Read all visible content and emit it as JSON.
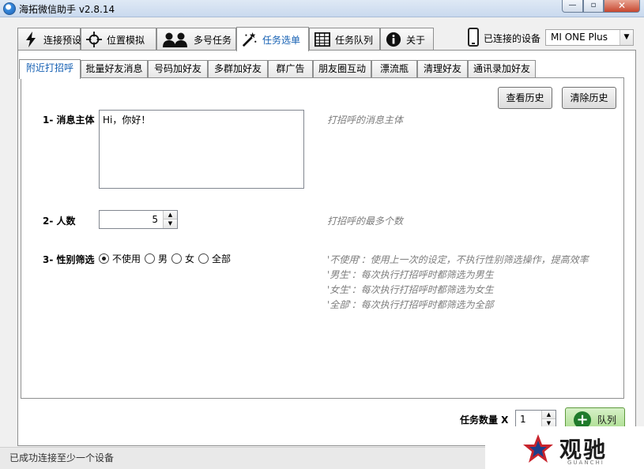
{
  "window": {
    "title": "海拓微信助手 v2.8.14"
  },
  "main_tabs": [
    {
      "label": "连接预设",
      "icon": "lightning-icon"
    },
    {
      "label": "位置模拟",
      "icon": "crosshair-icon"
    },
    {
      "label": "多号任务",
      "icon": "users-icon"
    },
    {
      "label": "任务选单",
      "icon": "magic-wand-icon"
    },
    {
      "label": "任务队列",
      "icon": "grid-icon"
    },
    {
      "label": "关于",
      "icon": "info-icon"
    }
  ],
  "device": {
    "label": "已连接的设备",
    "selected": "MI ONE Plus"
  },
  "sub_tabs": [
    "附近打招呼",
    "批量好友消息",
    "号码加好友",
    "多群加好友",
    "群广告",
    "朋友圈互动",
    "漂流瓶",
    "清理好友",
    "通讯录加好友"
  ],
  "buttons": {
    "history": "查看历史",
    "clear": "清除历史"
  },
  "form": {
    "message": {
      "label": "1- 消息主体",
      "value": "Hi，你好！",
      "hint": "打招呼的消息主体"
    },
    "count": {
      "label": "2- 人数",
      "value": "5",
      "hint": "打招呼的最多个数"
    },
    "gender": {
      "label": "3- 性别筛选",
      "options": [
        "不使用",
        "男",
        "女",
        "全部"
      ],
      "selected": "不使用",
      "hints": [
        "'不使用'：使用上一次的设定，不执行性别筛选操作，提高效率",
        "'男生'：每次执行打招呼时都筛选为男生",
        "'女生'：每次执行打招呼时都筛选为女生",
        "'全部'：每次执行打招呼时都筛选为全部"
      ]
    }
  },
  "task": {
    "count_label": "任务数量 X",
    "count_value": "1",
    "queue_label": "队列"
  },
  "status": {
    "text": "已成功连接至少一个设备"
  },
  "watermark": {
    "text": "观驰",
    "sub": "GUANCHI"
  },
  "colors": {
    "active_tab": "#1560b3",
    "hint": "#7c7c7c",
    "queue_green": "#1f7a2b"
  }
}
